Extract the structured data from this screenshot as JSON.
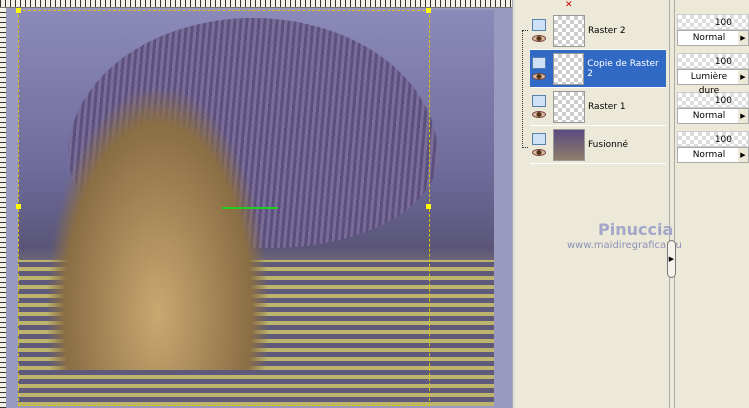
{
  "layers": [
    {
      "name": "Raster 2",
      "opacity": "100",
      "blend": "Normal",
      "selected": false
    },
    {
      "name": "Copie de Raster 2",
      "opacity": "100",
      "blend": "Lumière dure",
      "selected": true
    },
    {
      "name": "Raster 1",
      "opacity": "100",
      "blend": "Normal",
      "selected": false
    },
    {
      "name": "Fusionné",
      "opacity": "100",
      "blend": "Normal",
      "selected": false
    }
  ],
  "watermark": {
    "name": "Pinuccia",
    "url": "www.maidiregrafica.eu"
  },
  "colors": {
    "selected": "#316ac5",
    "panel": "#ece9d8"
  }
}
